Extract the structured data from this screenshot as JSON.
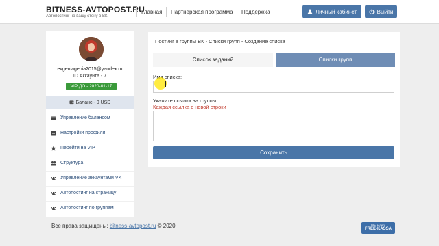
{
  "header": {
    "brand": "BITNESS-AVTOPOST.RU",
    "tagline": "Автопостинг на вашу стену в ВК",
    "nav": [
      "Главная",
      "Партнерская программа",
      "Поддержка"
    ],
    "cabinet_label": "Личный кабинет",
    "logout_label": "Выйти"
  },
  "profile": {
    "email": "evgeniagenia2015@yandex.ru",
    "account_id": "ID Аккаунта - 7",
    "vip": "VIP ДО - 2020-01-17",
    "balance": "Баланс - 0 USD"
  },
  "sidebar": {
    "items": [
      {
        "label": "Управление балансом",
        "icon": "card-icon"
      },
      {
        "label": "Настройки профиля",
        "icon": "settings-icon"
      },
      {
        "label": "Перейти на VIP",
        "icon": "star-icon"
      },
      {
        "label": "Структура",
        "icon": "users-icon"
      },
      {
        "label": "Управление аккаунтами VK",
        "icon": "vk-icon"
      },
      {
        "label": "Автопостинг на страницу",
        "icon": "vk-icon"
      },
      {
        "label": "Автопостинг по группам",
        "icon": "vk-icon"
      }
    ]
  },
  "main": {
    "breadcrumb": "Постинг в группы ВК - Списки групп - Создание списка",
    "tabs": [
      {
        "label": "Список заданий",
        "active": false
      },
      {
        "label": "Списки групп",
        "active": true
      }
    ],
    "list_name_label": "Имя списка:",
    "list_name_value": "",
    "links_label": "Укажите ссылки на группы:",
    "links_hint": "Каждая ссылка с новой строки",
    "links_value": "",
    "save_label": "Сохранить"
  },
  "footer": {
    "rights_prefix": "Все права защищены:",
    "link": "bitness-avtopost.ru",
    "suffix": "© 2020",
    "badge_line1": "We accept",
    "badge_line2": "FREE-KASSA"
  },
  "colors": {
    "accent": "#4a76a8",
    "active_tab": "#6f8db5",
    "vip_badge": "#3a9a3a",
    "hint_red": "#c0392b"
  }
}
